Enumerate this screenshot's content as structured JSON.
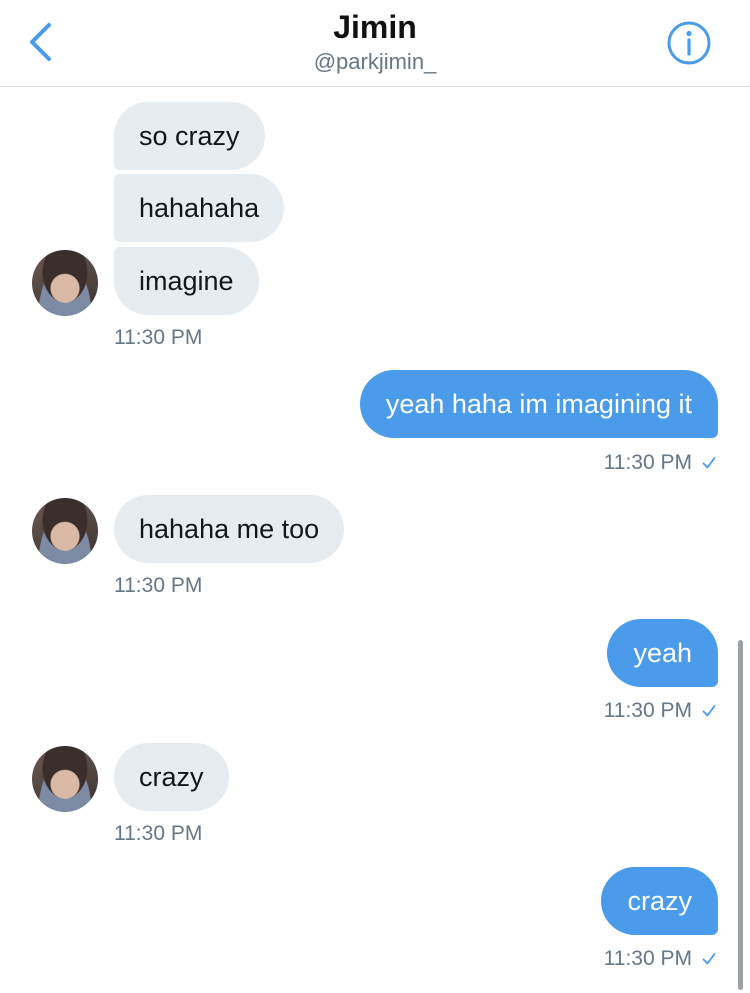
{
  "header": {
    "title": "Jimin",
    "handle": "@parkjimin_",
    "back_icon": "chevron-left-icon",
    "info_icon": "info-icon"
  },
  "messages": {
    "group1": {
      "bubbles": [
        "so crazy",
        "hahahaha",
        "imagine"
      ],
      "time": "11:30 PM"
    },
    "sent1": {
      "text": "yeah haha im imagining it",
      "time": "11:30 PM"
    },
    "recv2": {
      "text": "hahaha me too",
      "time": "11:30 PM"
    },
    "sent2": {
      "text": "yeah",
      "time": "11:30 PM"
    },
    "recv3": {
      "text": "crazy",
      "time": "11:30 PM"
    },
    "sent3": {
      "text": "crazy",
      "time": "11:30 PM"
    }
  },
  "colors": {
    "accent": "#4a9be9",
    "incoming_bubble": "#e6ecf0",
    "timestamp": "#657786"
  }
}
